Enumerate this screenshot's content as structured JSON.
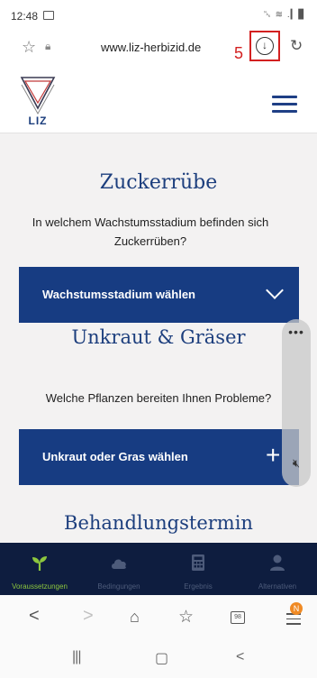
{
  "status_bar": {
    "time": "12:48",
    "icons_text": "␕ ≋ .▎▊"
  },
  "browser": {
    "url": "www.liz-herbizid.de",
    "annotation_label": "5"
  },
  "site": {
    "logo_text": "LIZ"
  },
  "main": {
    "section1_title": "Zuckerrübe",
    "section1_question": "In welchem Wachstumsstadium befinden sich Zuckerrüben?",
    "panel1_label": "Wachstumsstadium wählen",
    "section2_title": "Unkraut & Gräser",
    "section2_question": "Welche Pflanzen bereiten Ihnen Probleme?",
    "panel2_label": "Unkraut oder Gras wählen",
    "section3_title": "Behandlungstermin"
  },
  "bottom_nav": {
    "items": [
      {
        "label": "Voraussetzungen",
        "icon": "sprout-icon",
        "active": true
      },
      {
        "label": "Bedingungen",
        "icon": "cloud-icon",
        "active": false
      },
      {
        "label": "Ergebnis",
        "icon": "calculator-icon",
        "active": false
      },
      {
        "label": "Alternativen",
        "icon": "person-icon",
        "active": false
      }
    ]
  },
  "browser_toolbar": {
    "tabs_count": "98",
    "menu_badge": "N"
  },
  "colors": {
    "brand_blue": "#173c82",
    "nav_bg": "#0e1d3f",
    "active_green": "#8cc63e",
    "annotation_red": "#d32020"
  }
}
